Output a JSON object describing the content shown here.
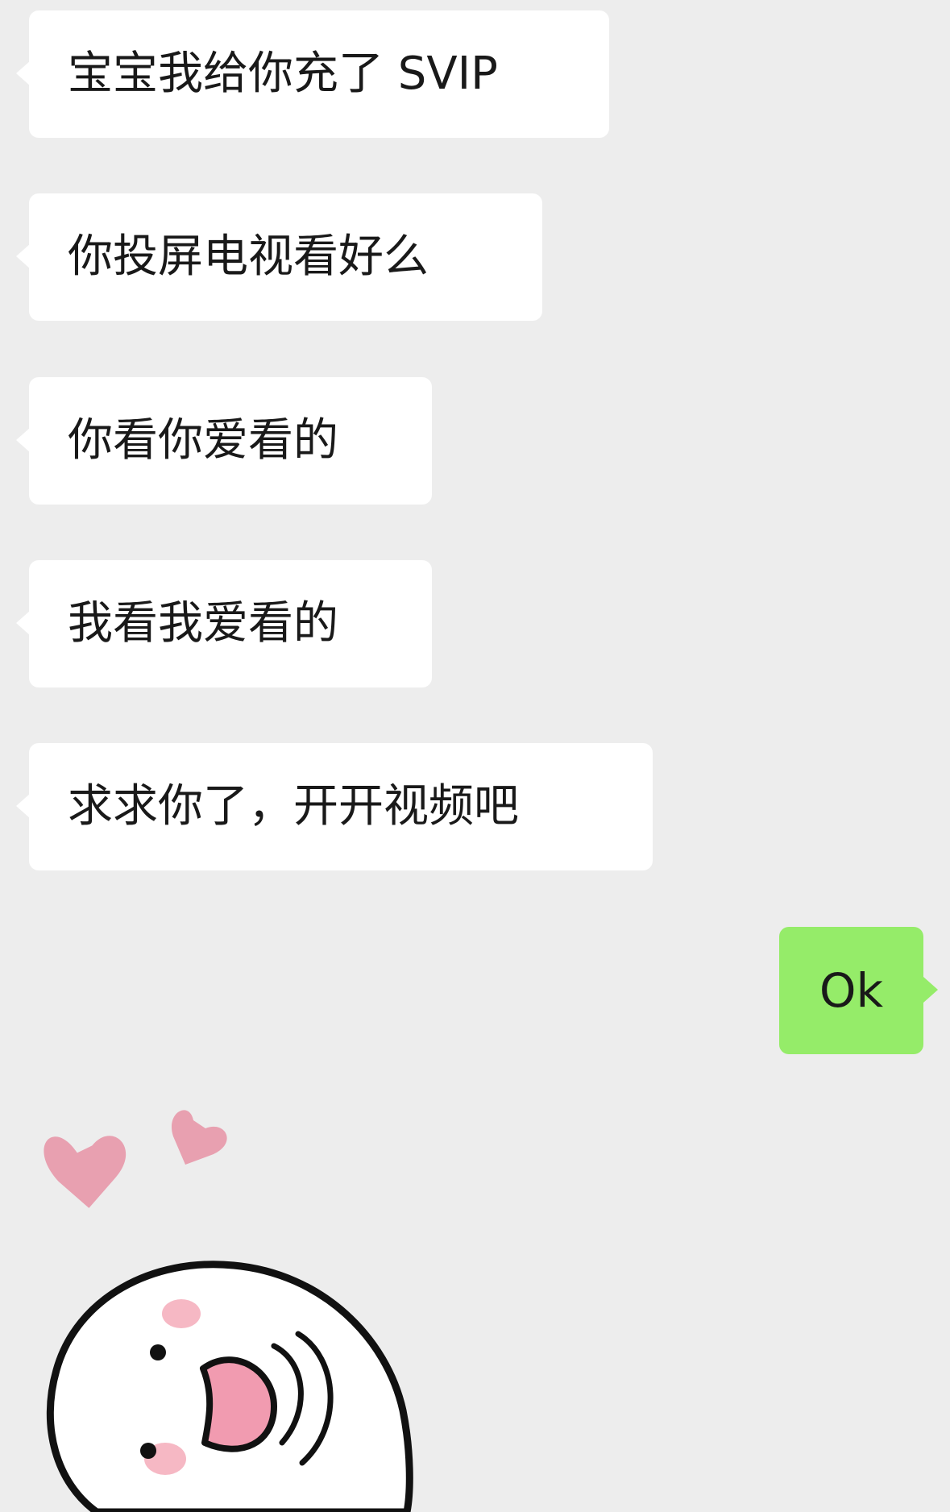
{
  "messages": [
    {
      "direction": "incoming",
      "text": "宝宝我给你充了 SVIP"
    },
    {
      "direction": "incoming",
      "text": "你投屏电视看好么"
    },
    {
      "direction": "incoming",
      "text": "你看你爱看的"
    },
    {
      "direction": "incoming",
      "text": "我看我爱看的"
    },
    {
      "direction": "incoming",
      "text": "求求你了，开开视频吧"
    },
    {
      "direction": "outgoing",
      "text": "Ok"
    }
  ],
  "sticker": {
    "icon": "happy-ghost-sticker-icon",
    "hearts": 2
  },
  "colors": {
    "background": "#ededed",
    "incoming_bubble": "#ffffff",
    "outgoing_bubble": "#95ec69",
    "text": "#191919",
    "heart": "#e8a0b0",
    "blush": "#f6b8c4"
  }
}
